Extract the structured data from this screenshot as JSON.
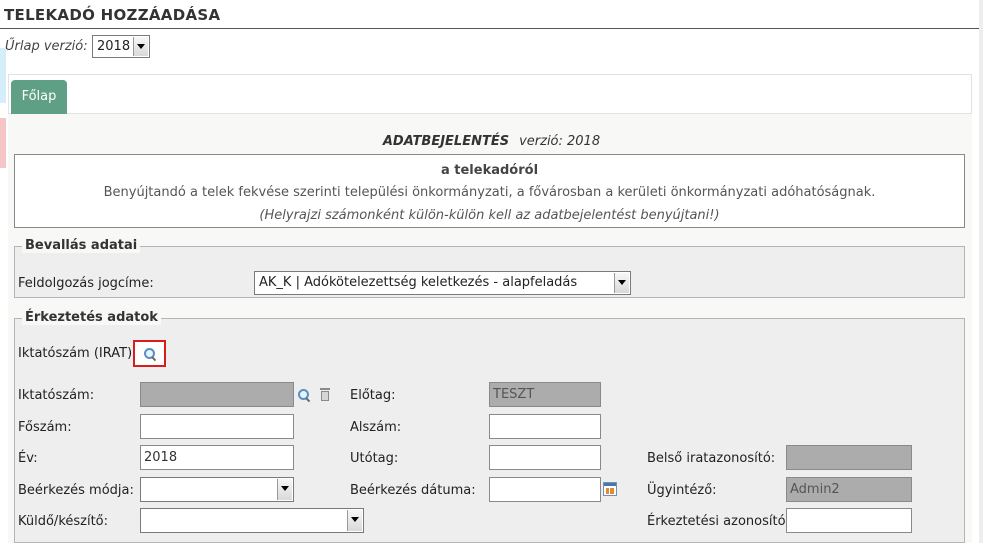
{
  "page": {
    "title": "TELEKADÓ HOZZÁADÁSA",
    "form_version_label": "Űrlap verzió:",
    "form_version_value": "2018"
  },
  "tabs": [
    {
      "label": "Főlap",
      "active": true
    }
  ],
  "declaration": {
    "heading": "ADATBEJELENTÉS",
    "version": "verzió: 2018",
    "subtitle": "a telekadóról",
    "line2": "Benyújtandó a telek fekvése szerinti települési önkormányzati, a fővárosban a kerületi önkormányzati adóhatóságnak.",
    "line3": "(Helyrajzi számonként külön-külön kell az adatbejelentést benyújtani!)"
  },
  "bevallas": {
    "legend": "Bevallás adatai",
    "jogcim_label": "Feldolgozás jogcíme:",
    "jogcim_value": "AK_K | Adókötelezettség keletkezés - alapfeladás"
  },
  "erkeztetes": {
    "legend": "Érkeztetés adatok",
    "irat_label": "Iktatószám (IRAT):",
    "iktatoszam_label": "Iktatószám:",
    "iktatoszam_value": "",
    "elotag_label": "Előtag:",
    "elotag_value": "TESZT",
    "foszam_label": "Főszám:",
    "foszam_value": "",
    "alszam_label": "Alszám:",
    "alszam_value": "",
    "ev_label": "Év:",
    "ev_value": "2018",
    "utotag_label": "Utótag:",
    "utotag_value": "",
    "belso_label": "Belső iratazonosító:",
    "belso_value": "",
    "beerkezes_modja_label": "Beérkezés módja:",
    "beerkezes_modja_value": "",
    "beerkezes_datuma_label": "Beérkezés dátuma:",
    "beerkezes_datuma_value": "",
    "ugyintezo_label": "Ügyintéző:",
    "ugyintezo_value": "Admin2",
    "kuldo_label": "Küldő/készítő:",
    "kuldo_value": "",
    "erkeztetesi_label": "Érkeztetési azonosító:",
    "erkeztetesi_value": ""
  },
  "icons": {
    "search": "search-icon",
    "trash": "trash-icon",
    "calendar": "calendar-icon",
    "dropdown": "chevron-down-icon"
  },
  "colors": {
    "tab_active": "#5e9f86",
    "highlight": "#d81d1d",
    "readonly": "#acacac"
  }
}
